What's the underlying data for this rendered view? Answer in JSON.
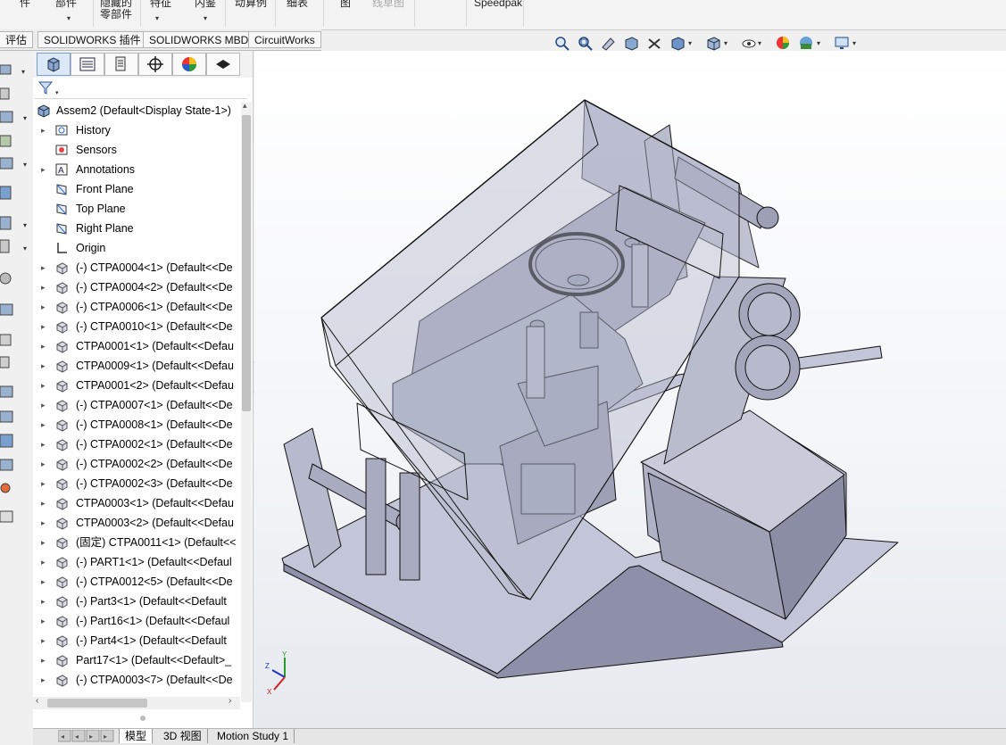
{
  "ribbon": {
    "items": [
      "件",
      "部件",
      "隐藏的零部件",
      "特征",
      "内鉴",
      "动算例",
      "细表",
      "图",
      "线草图",
      "Speedpak"
    ]
  },
  "command_tabs": [
    "评估",
    "SOLIDWORKS 插件",
    "SOLIDWORKS MBD",
    "CircuitWorks"
  ],
  "feature_tree": {
    "root": "Assem2  (Default<Display State-1>)",
    "items": [
      {
        "label": "History",
        "icon": "history-icon"
      },
      {
        "label": "Sensors",
        "icon": "sensor-icon"
      },
      {
        "label": "Annotations",
        "icon": "annotations-icon"
      },
      {
        "label": "Front Plane",
        "icon": "plane-icon"
      },
      {
        "label": "Top Plane",
        "icon": "plane-icon"
      },
      {
        "label": "Right Plane",
        "icon": "plane-icon"
      },
      {
        "label": "Origin",
        "icon": "origin-icon"
      },
      {
        "label": "(-) CTPA0004<1> (Default<<De",
        "icon": "part-icon"
      },
      {
        "label": "(-) CTPA0004<2> (Default<<De",
        "icon": "part-icon"
      },
      {
        "label": "(-) CTPA0006<1> (Default<<De",
        "icon": "part-icon"
      },
      {
        "label": "(-) CTPA0010<1> (Default<<De",
        "icon": "part-icon"
      },
      {
        "label": "CTPA0001<1> (Default<<Defau",
        "icon": "part-icon"
      },
      {
        "label": "CTPA0009<1> (Default<<Defau",
        "icon": "part-icon"
      },
      {
        "label": "CTPA0001<2> (Default<<Defau",
        "icon": "part-icon"
      },
      {
        "label": "(-) CTPA0007<1> (Default<<De",
        "icon": "part-icon"
      },
      {
        "label": "(-) CTPA0008<1> (Default<<De",
        "icon": "part-icon"
      },
      {
        "label": "(-) CTPA0002<1> (Default<<De",
        "icon": "part-icon"
      },
      {
        "label": "(-) CTPA0002<2> (Default<<De",
        "icon": "part-icon"
      },
      {
        "label": "(-) CTPA0002<3> (Default<<De",
        "icon": "part-icon"
      },
      {
        "label": "CTPA0003<1> (Default<<Defau",
        "icon": "part-icon"
      },
      {
        "label": "CTPA0003<2> (Default<<Defau",
        "icon": "part-icon"
      },
      {
        "label": "(固定) CTPA0011<1> (Default<<",
        "icon": "part-icon"
      },
      {
        "label": "(-) PART1<1> (Default<<Defaul",
        "icon": "part-icon"
      },
      {
        "label": "(-) CTPA0012<5> (Default<<De",
        "icon": "part-icon"
      },
      {
        "label": "(-) Part3<1> (Default<<Default",
        "icon": "part-icon"
      },
      {
        "label": "(-) Part16<1> (Default<<Defaul",
        "icon": "part-icon"
      },
      {
        "label": "(-) Part4<1> (Default<<Default",
        "icon": "part-icon"
      },
      {
        "label": "Part17<1> (Default<<Default>_",
        "icon": "part-icon"
      },
      {
        "label": "(-) CTPA0003<7> (Default<<De",
        "icon": "part-icon"
      }
    ]
  },
  "bottom_tabs": [
    "模型",
    "3D 视图",
    "Motion Study 1"
  ],
  "triad": {
    "x": "X",
    "y": "Y",
    "z": "Z"
  },
  "colors": {
    "model": "#b7b9cc",
    "model_dark": "#8f92aa",
    "edge": "#1a1a1a",
    "accent": "#7aa0cf"
  }
}
